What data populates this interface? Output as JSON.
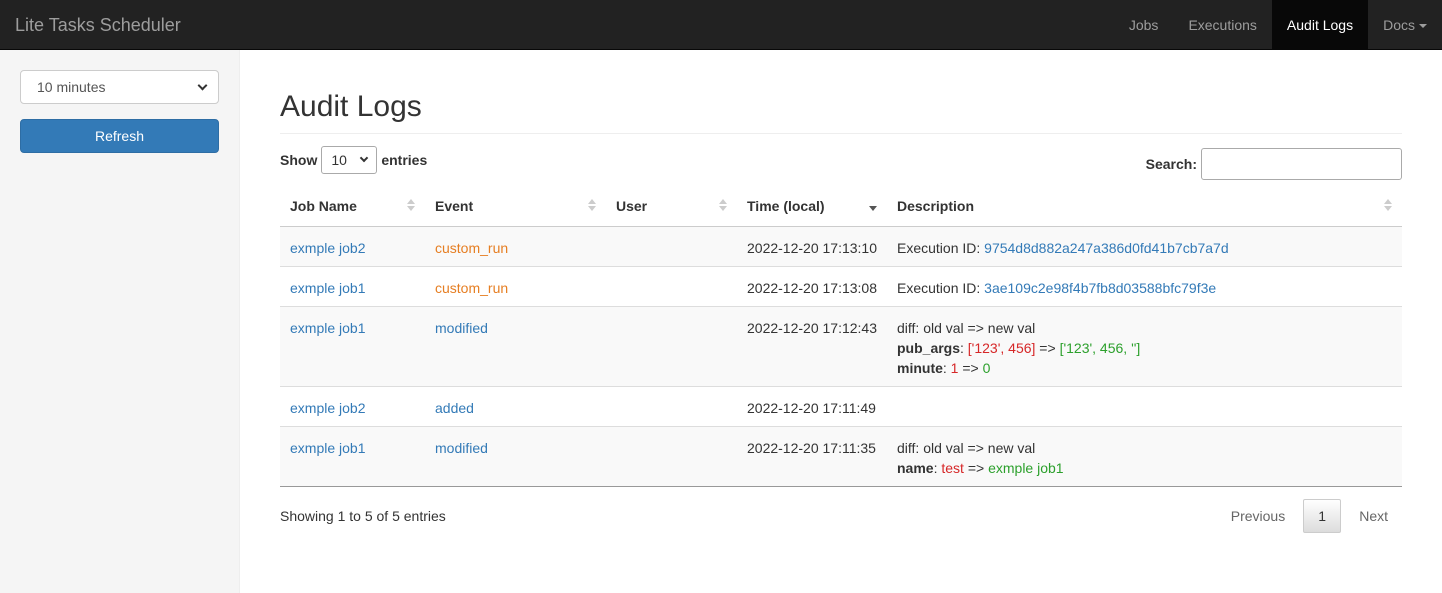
{
  "navbar": {
    "brand": "Lite Tasks Scheduler",
    "items": [
      {
        "label": "Jobs"
      },
      {
        "label": "Executions"
      },
      {
        "label": "Audit Logs"
      },
      {
        "label": "Docs"
      }
    ],
    "active": "Audit Logs"
  },
  "sidebar": {
    "interval_value": "10 minutes",
    "refresh_label": "Refresh"
  },
  "page": {
    "title": "Audit Logs"
  },
  "table_controls": {
    "show_label": "Show",
    "length_value": "10",
    "entries_label": "entries",
    "search_label": "Search:",
    "search_value": ""
  },
  "table": {
    "columns": [
      "Job Name",
      "Event",
      "User",
      "Time (local)",
      "Description"
    ],
    "rows": [
      {
        "job": "exmple job2",
        "event": "custom_run",
        "user": "",
        "time": "2022-12-20 17:13:10",
        "desc_prefix": "Execution ID: ",
        "desc_link": "9754d8d882a247a386d0fd41b7cb7a7d"
      },
      {
        "job": "exmple job1",
        "event": "custom_run",
        "user": "",
        "time": "2022-12-20 17:13:08",
        "desc_prefix": "Execution ID: ",
        "desc_link": "3ae109c2e98f4b7fb8d03588bfc79f3e"
      },
      {
        "job": "exmple job1",
        "event": "modified",
        "user": "",
        "time": "2022-12-20 17:12:43",
        "diff_header": "diff: old val => new val",
        "diffs": [
          {
            "key": "pub_args",
            "old": "['123', 456]",
            "arrow": " => ",
            "new": "['123', 456, '']"
          },
          {
            "key": "minute",
            "old": "1",
            "arrow": " => ",
            "new": "0"
          }
        ]
      },
      {
        "job": "exmple job2",
        "event": "added",
        "user": "",
        "time": "2022-12-20 17:11:49"
      },
      {
        "job": "exmple job1",
        "event": "modified",
        "user": "",
        "time": "2022-12-20 17:11:35",
        "diff_header": "diff: old val => new val",
        "diffs": [
          {
            "key": "name",
            "old": "test",
            "arrow": " => ",
            "new": "exmple job1"
          }
        ]
      }
    ]
  },
  "footer": {
    "info": "Showing 1 to 5 of 5 entries",
    "previous": "Previous",
    "page": "1",
    "next": "Next"
  },
  "colors": {
    "navbar_bg": "#222222",
    "link": "#337ab7",
    "custom_run": "#e67e22",
    "old_value": "#d62728",
    "new_value": "#2ca02c",
    "primary_button": "#337ab7"
  }
}
